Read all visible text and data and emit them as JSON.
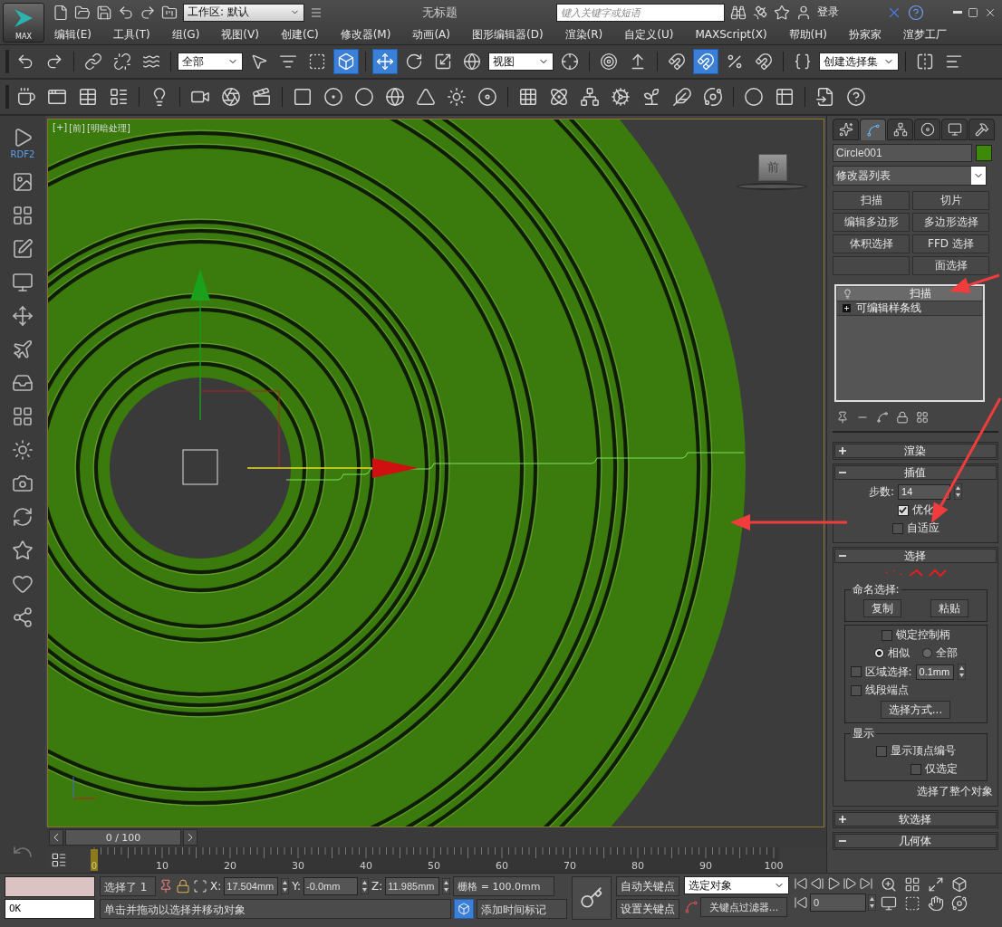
{
  "app_button": {
    "label": "MAX"
  },
  "title_bar": {
    "workspace": "工作区: 默认",
    "title": "无标题",
    "search_placeholder": "键入关键字或短语",
    "login": "登录"
  },
  "menu": [
    "编辑(E)",
    "工具(T)",
    "组(G)",
    "视图(V)",
    "创建(C)",
    "修改器(M)",
    "动画(A)",
    "图形编辑器(D)",
    "渲染(R)",
    "自定义(U)",
    "MAXScript(X)",
    "帮助(H)",
    "扮家家",
    "渲梦工厂"
  ],
  "main_toolbar": [
    {
      "kind": "undo",
      "selected": false
    },
    {
      "kind": "redo",
      "selected": false
    },
    {
      "kind": "separator"
    },
    {
      "kind": "link",
      "selected": false
    },
    {
      "kind": "unlink",
      "selected": false
    },
    {
      "kind": "bind",
      "selected": false
    },
    {
      "kind": "separator"
    },
    {
      "kind": "dropdown",
      "value": "全部"
    },
    {
      "kind": "select",
      "selected": false
    },
    {
      "kind": "select_by_name",
      "selected": false
    },
    {
      "kind": "region",
      "selected": false
    },
    {
      "kind": "crossing",
      "selected": true
    },
    {
      "kind": "separator"
    },
    {
      "kind": "move",
      "selected": true
    },
    {
      "kind": "rotate",
      "selected": false
    },
    {
      "kind": "scale",
      "selected": false
    },
    {
      "kind": "placement",
      "selected": false
    },
    {
      "kind": "dropdown",
      "value": "视图"
    },
    {
      "kind": "pivot",
      "selected": false
    },
    {
      "kind": "separator"
    },
    {
      "kind": "manipulate",
      "selected": false
    },
    {
      "kind": "keyboard",
      "selected": false
    },
    {
      "kind": "separator"
    },
    {
      "kind": "snap",
      "selected": false
    },
    {
      "kind": "angle_snap",
      "selected": true
    },
    {
      "kind": "percent_snap",
      "selected": false
    },
    {
      "kind": "spinner_snap",
      "selected": false
    },
    {
      "kind": "separator"
    },
    {
      "kind": "named_sets",
      "selected": false
    },
    {
      "kind": "dropdown",
      "value": "创建选择集"
    },
    {
      "kind": "separator"
    },
    {
      "kind": "mirror",
      "selected": false
    },
    {
      "kind": "align",
      "selected": false
    }
  ],
  "sidebar": {
    "label": "RDF2"
  },
  "viewport": {
    "labels": [
      "[+]",
      "[前]",
      "[明暗处理]"
    ],
    "viewcube_label": "前"
  },
  "time_slider": {
    "position": "0 / 100"
  },
  "track_bar": {
    "current_frame": "0",
    "ticks": [
      "10",
      "20",
      "30",
      "40",
      "50",
      "60",
      "70",
      "80",
      "90",
      "100"
    ]
  },
  "command_panel": {
    "tabs": [
      {
        "kind": "create",
        "selected": false
      },
      {
        "kind": "modify",
        "selected": true
      },
      {
        "kind": "hierarchy",
        "selected": false
      },
      {
        "kind": "motion",
        "selected": false
      },
      {
        "kind": "display",
        "selected": false
      },
      {
        "kind": "utilities",
        "selected": false
      }
    ],
    "object_name": "Circle001",
    "modifier_list": "修改器列表",
    "modifier_buttons": [
      {
        "kind": "modifier",
        "label": "扫描"
      },
      {
        "kind": "modifier",
        "label": "切片"
      },
      {
        "kind": "modifier",
        "label": "编辑多边形"
      },
      {
        "kind": "modifier",
        "label": "多边形选择"
      },
      {
        "kind": "modifier",
        "label": "体积选择"
      },
      {
        "kind": "modifier",
        "label": "FFD 选择"
      },
      {
        "kind": "blank"
      },
      {
        "kind": "modifier",
        "label": "面选择"
      }
    ],
    "stack": [
      {
        "kind": "modifier",
        "label": "扫描",
        "selected": true
      },
      {
        "kind": "base",
        "label": "可编辑样条线",
        "selected": false
      }
    ],
    "rollouts": [
      {
        "kind": "render",
        "title": "渲染",
        "expanded": false
      },
      {
        "kind": "interpolation",
        "title": "插值",
        "expanded": true,
        "steps_label": "步数:",
        "steps": "14",
        "optimize": {
          "label": "优化",
          "checked": true
        },
        "adaptive": {
          "label": "自适应",
          "checked": false
        }
      },
      {
        "kind": "selection",
        "title": "选择",
        "expanded": true,
        "named_label": "命名选择:",
        "copy": "复制",
        "paste": "粘贴",
        "lock_handles": {
          "label": "锁定控制柄",
          "checked": false
        },
        "handle_modes": [
          {
            "label": "相似",
            "selected": true
          },
          {
            "label": "全部",
            "selected": false
          }
        ],
        "area": {
          "label": "区域选择:",
          "checked": false,
          "value": "0.1mm"
        },
        "segment_end": {
          "label": "线段端点",
          "checked": false
        },
        "select_by": "选择方式...",
        "display_label": "显示",
        "show_numbers": {
          "label": "显示顶点编号",
          "checked": false
        },
        "selected_only": {
          "label": "仅选定",
          "checked": false
        },
        "status": "选择了整个对象"
      },
      {
        "kind": "soft",
        "title": "软选择",
        "expanded": false
      },
      {
        "kind": "geometry",
        "title": "几何体",
        "expanded": true
      }
    ]
  },
  "status": {
    "listener": "OK",
    "selection": "选择了 1",
    "x_label": "X:",
    "x": "17.504mm",
    "y_label": "Y:",
    "y": "-0.0mm",
    "z_label": "Z:",
    "z": "11.985mm",
    "grid": "栅格 = 100.0mm",
    "prompt": "单击并拖动以选择并移动对象",
    "add_time_tag": "添加时间标记",
    "auto_key": {
      "label": "自动关键点",
      "selected": false
    },
    "set_key": "设置关键点",
    "key_target": "选定对象",
    "key_filters": "关键点过滤器...",
    "frame": "0"
  }
}
